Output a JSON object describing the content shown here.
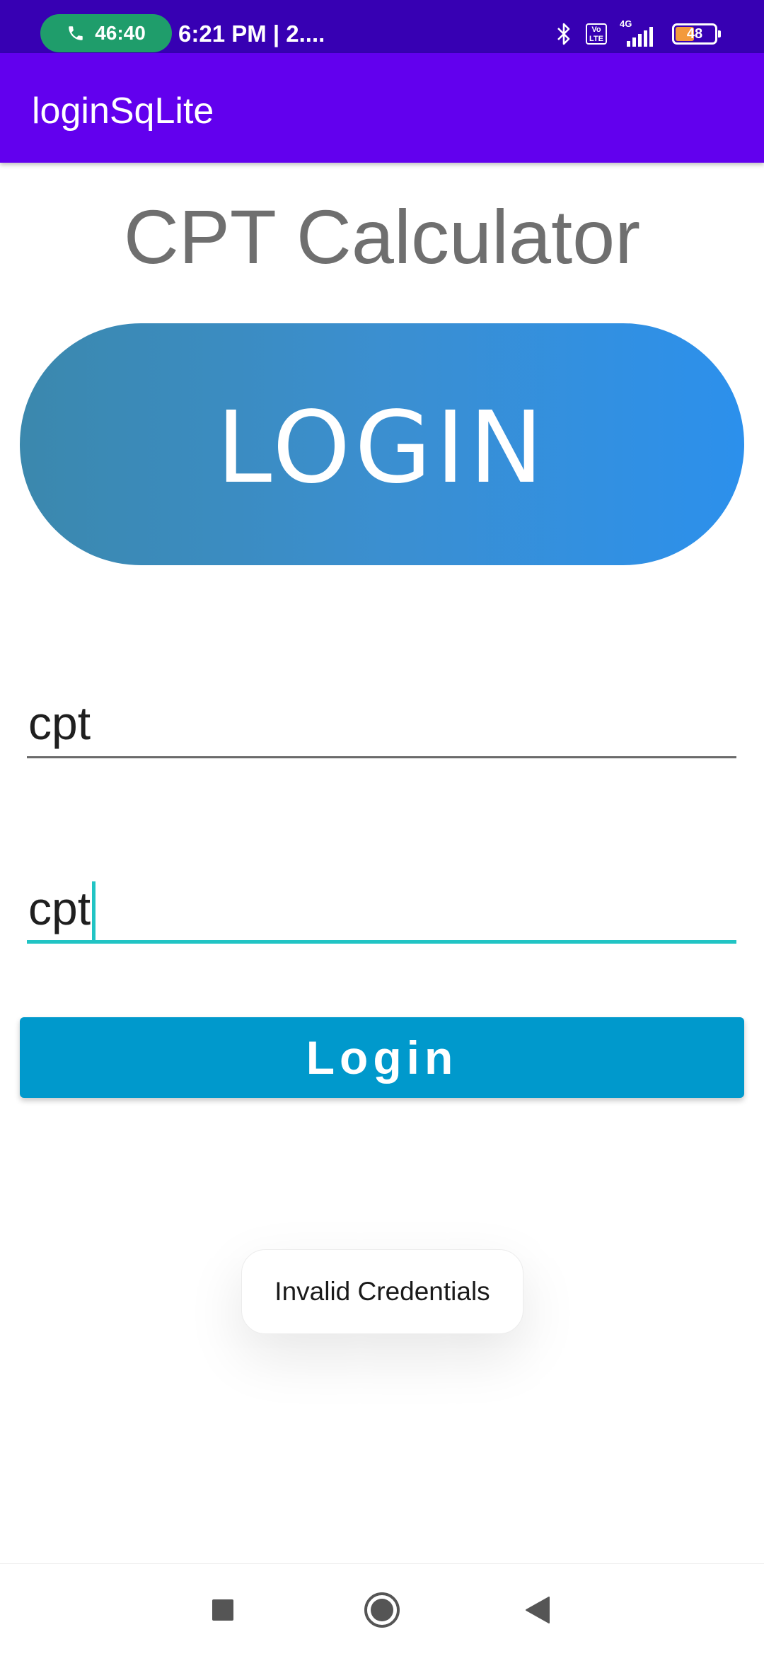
{
  "status_bar": {
    "call_timer": "46:40",
    "time": "6:21 PM | 2....",
    "volte_label": "Vo LTE",
    "network_label": "4G",
    "battery_level": "48",
    "icons": [
      "phone-icon",
      "bluetooth-icon",
      "volte-icon",
      "signal-icon",
      "battery-icon"
    ]
  },
  "app_bar": {
    "title": "loginSqLite"
  },
  "main": {
    "heading": "CPT Calculator",
    "banner_text": "LOGIN",
    "username_value": "cpt",
    "password_value": "cpt",
    "login_button_label": "Login"
  },
  "toast": {
    "message": "Invalid Credentials"
  },
  "nav_bar": {
    "icons": [
      "recents-icon",
      "home-icon",
      "back-icon"
    ]
  },
  "colors": {
    "status_bar": "#3700b3",
    "app_bar": "#6200ee",
    "login_button": "#0099cc",
    "field_focus": "#21c4c4",
    "heading_text": "#6f6f6f"
  }
}
